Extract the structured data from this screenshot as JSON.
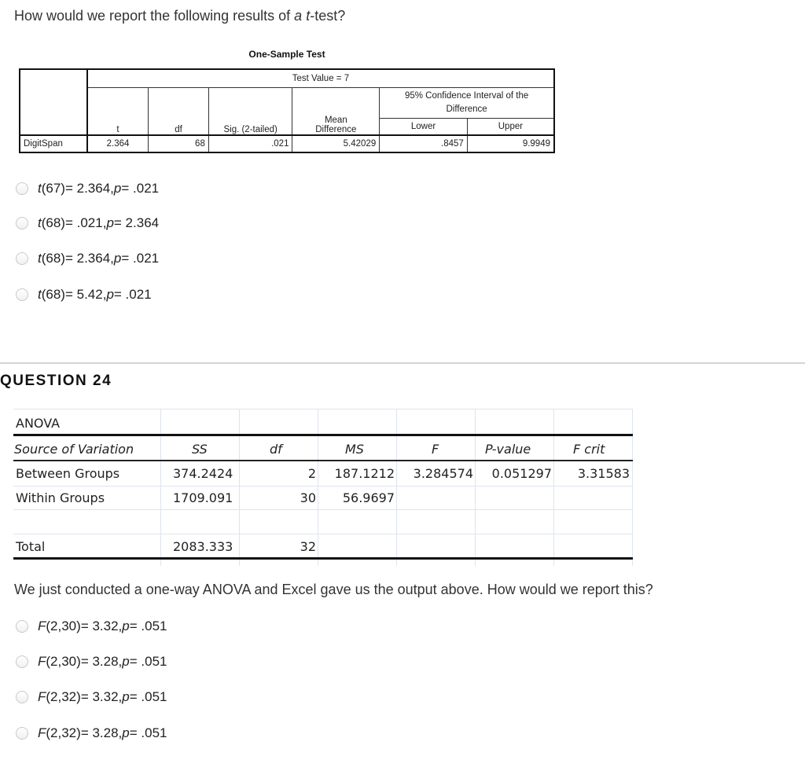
{
  "question23": {
    "prompt_prefix": "How would we report the following results of ",
    "prompt_a": "a",
    "prompt_space": " ",
    "prompt_t": "t",
    "prompt_suffix": "-test?",
    "table": {
      "title": "One-Sample Test",
      "test_value_label": "Test Value = 7",
      "ci_header": "95% Confidence Interval of the Difference",
      "columns": [
        "t",
        "df",
        "Sig. (2-tailed)",
        "Mean Difference",
        "Lower",
        "Upper"
      ],
      "mean_diff_line1": "Mean",
      "mean_diff_line2": "Difference",
      "row": {
        "label": "DigitSpan",
        "t": "2.364",
        "df": "68",
        "sig": ".021",
        "mean_difference": "5.42029",
        "lower": ".8457",
        "upper": "9.9949"
      }
    },
    "options": [
      {
        "stat": "t",
        "df": "(67)",
        "value": " = 2.364, ",
        "p": "p",
        "p_value": " = .021"
      },
      {
        "stat": "t",
        "df": "(68)",
        "value": " = .021, ",
        "p": "p",
        "p_value": " = 2.364"
      },
      {
        "stat": "t",
        "df": "(68)",
        "value": " = 2.364, ",
        "p": "p",
        "p_value": " = .021"
      },
      {
        "stat": "t",
        "df": "(68)",
        "value": " = 5.42, ",
        "p": "p",
        "p_value": " = .021"
      }
    ]
  },
  "question24": {
    "heading": "QUESTION 24",
    "anova": {
      "title": "ANOVA",
      "columns": [
        "Source of Variation",
        "SS",
        "df",
        "MS",
        "F",
        "P-value",
        "F crit"
      ],
      "rows": [
        {
          "source": "Between Groups",
          "ss": "374.2424",
          "df": "2",
          "ms": "187.1212",
          "f": "3.284574",
          "p": "0.051297",
          "fcrit": "3.31583"
        },
        {
          "source": "Within Groups",
          "ss": "1709.091",
          "df": "30",
          "ms": "56.9697",
          "f": "",
          "p": "",
          "fcrit": ""
        },
        {
          "source": "Total",
          "ss": "2083.333",
          "df": "32",
          "ms": "",
          "f": "",
          "p": "",
          "fcrit": ""
        }
      ]
    },
    "prompt": "We just conducted a one-way ANOVA and Excel gave us the output above.  How would we report this?",
    "options": [
      {
        "stat": "F",
        "df": "(2,30)",
        "value": " = 3.32, ",
        "p": "p",
        "p_value": " = .051"
      },
      {
        "stat": "F",
        "df": "(2,30)",
        "value": " = 3.28, ",
        "p": "p",
        "p_value": " = .051"
      },
      {
        "stat": "F",
        "df": "(2,32)",
        "value": " = 3.32, ",
        "p": "p",
        "p_value": " = .051"
      },
      {
        "stat": "F",
        "df": "(2,32)",
        "value": " = 3.28, ",
        "p": "p",
        "p_value": " = .051"
      }
    ]
  }
}
